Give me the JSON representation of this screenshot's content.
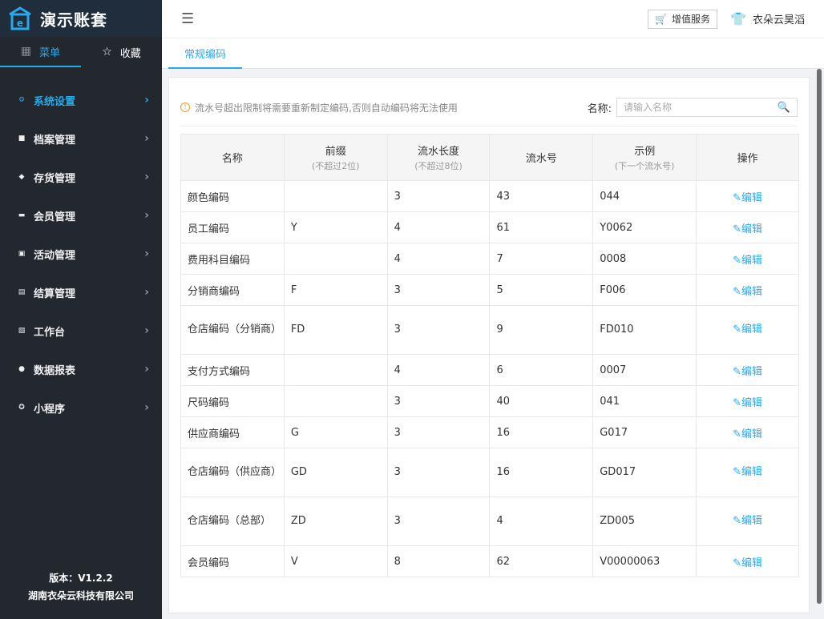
{
  "app": {
    "title": "演示账套",
    "version": "版本：V1.2.2",
    "company": "湖南衣朵云科技有限公司"
  },
  "sidebar": {
    "tabs": [
      {
        "label": "菜单",
        "icon": "grid-icon"
      },
      {
        "label": "收藏",
        "icon": "star-icon"
      }
    ],
    "items": [
      {
        "label": "系统设置",
        "icon": "settings-icon",
        "active": true
      },
      {
        "label": "档案管理",
        "icon": "archive-icon"
      },
      {
        "label": "存货管理",
        "icon": "box-icon"
      },
      {
        "label": "会员管理",
        "icon": "member-icon"
      },
      {
        "label": "活动管理",
        "icon": "gift-icon"
      },
      {
        "label": "结算管理",
        "icon": "wallet-icon"
      },
      {
        "label": "工作台",
        "icon": "chart-icon"
      },
      {
        "label": "数据报表",
        "icon": "pie-icon"
      },
      {
        "label": "小程序",
        "icon": "miniapp-icon"
      }
    ]
  },
  "header": {
    "value_added_label": "增值服务",
    "user_name": "衣朵云昊滔"
  },
  "tabs": [
    {
      "label": "常规编码"
    }
  ],
  "notice": {
    "text": "流水号超出限制将需要重新制定编码,否则自动编码将无法使用"
  },
  "search": {
    "label": "名称:",
    "placeholder": "请输入名称"
  },
  "table": {
    "headers": [
      {
        "title": "名称",
        "sub": ""
      },
      {
        "title": "前缀",
        "sub": "(不超过2位)"
      },
      {
        "title": "流水长度",
        "sub": "(不超过8位)"
      },
      {
        "title": "流水号",
        "sub": ""
      },
      {
        "title": "示例",
        "sub": "(下一个流水号)"
      },
      {
        "title": "操作",
        "sub": ""
      }
    ],
    "edit_label": "编辑",
    "rows": [
      {
        "name": "颜色编码",
        "prefix": "",
        "length": "3",
        "serial": "43",
        "example": "044"
      },
      {
        "name": "员工编码",
        "prefix": "Y",
        "length": "4",
        "serial": "61",
        "example": "Y0062"
      },
      {
        "name": "费用科目编码",
        "prefix": "",
        "length": "4",
        "serial": "7",
        "example": "0008"
      },
      {
        "name": "分销商编码",
        "prefix": "F",
        "length": "3",
        "serial": "5",
        "example": "F006"
      },
      {
        "name": "仓店编码（分销商）",
        "prefix": "FD",
        "length": "3",
        "serial": "9",
        "example": "FD010"
      },
      {
        "name": "支付方式编码",
        "prefix": "",
        "length": "4",
        "serial": "6",
        "example": "0007"
      },
      {
        "name": "尺码编码",
        "prefix": "",
        "length": "3",
        "serial": "40",
        "example": "041"
      },
      {
        "name": "供应商编码",
        "prefix": "G",
        "length": "3",
        "serial": "16",
        "example": "G017"
      },
      {
        "name": "仓店编码（供应商）",
        "prefix": "GD",
        "length": "3",
        "serial": "16",
        "example": "GD017"
      },
      {
        "name": "仓店编码（总部）",
        "prefix": "ZD",
        "length": "3",
        "serial": "4",
        "example": "ZD005"
      },
      {
        "name": "会员编码",
        "prefix": "V",
        "length": "8",
        "serial": "62",
        "example": "V00000063"
      }
    ]
  }
}
